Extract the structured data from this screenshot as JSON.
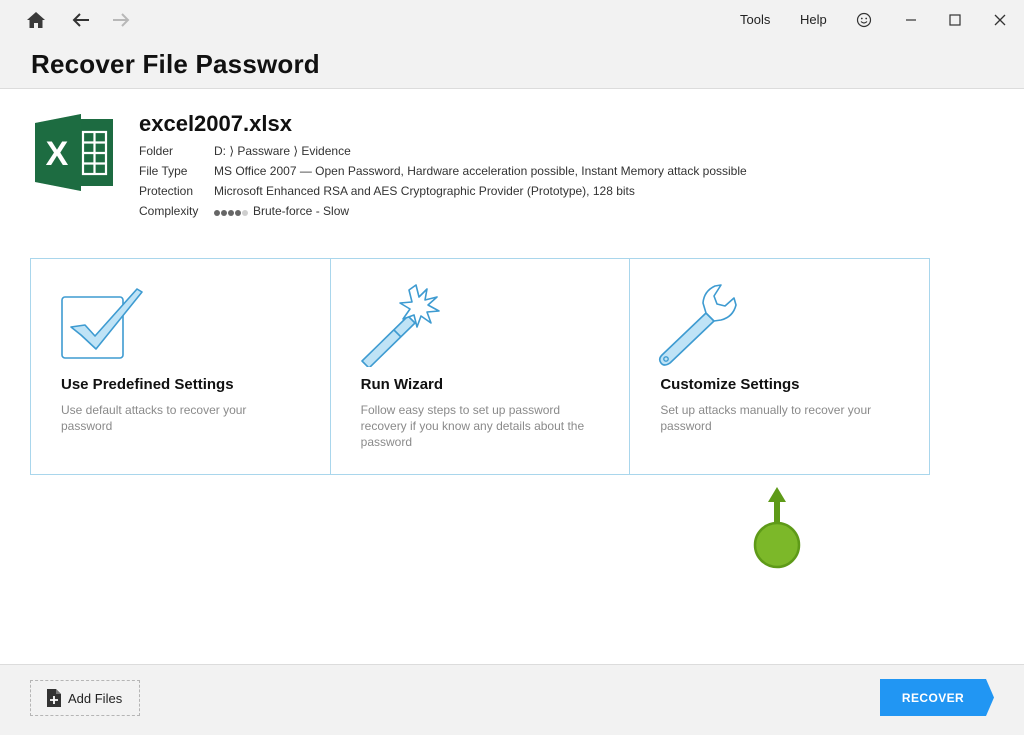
{
  "titlebar": {
    "menu": [
      {
        "label": "Tools",
        "name": "tools-menu"
      },
      {
        "label": "Help",
        "name": "help-menu"
      }
    ],
    "icons": [
      "home-icon",
      "back-arrow-icon",
      "forward-arrow-icon",
      "smiley-feedback-icon",
      "minimize-icon",
      "maximize-icon",
      "close-icon"
    ]
  },
  "page": {
    "title": "Recover File Password"
  },
  "file": {
    "name": "excel2007.xlsx",
    "icon": "excel-file-icon",
    "rows": [
      {
        "key": "Folder",
        "value": "D: ⟩ Passware ⟩ Evidence"
      },
      {
        "key": "File Type",
        "value": "MS Office 2007 — Open Password, Hardware acceleration possible, Instant Memory attack possible"
      },
      {
        "key": "Protection",
        "value": "Microsoft Enhanced RSA and AES Cryptographic Provider (Prototype), 128 bits"
      },
      {
        "key": "Complexity",
        "value": "Brute-force - Slow",
        "level": 4,
        "level_max": 5
      }
    ]
  },
  "options": [
    {
      "title": "Use Predefined Settings",
      "description": "Use default attacks to recover your password",
      "icon": "checkbox-icon"
    },
    {
      "title": "Run Wizard",
      "description": "Follow easy steps to set up password recovery if you know any details about the password",
      "icon": "magic-wand-icon"
    },
    {
      "title": "Customize Settings",
      "description": "Set up attacks manually to recover your password",
      "icon": "wrench-icon"
    }
  ],
  "footer": {
    "add_files": "Add Files",
    "recover": "RECOVER"
  },
  "colors": {
    "accent_blue": "#2196f3",
    "card_border": "#a9d6ec",
    "excel_green": "#1d6b41",
    "pointer_green": "#7cb829",
    "chrome_bg": "#f2f2f2"
  }
}
